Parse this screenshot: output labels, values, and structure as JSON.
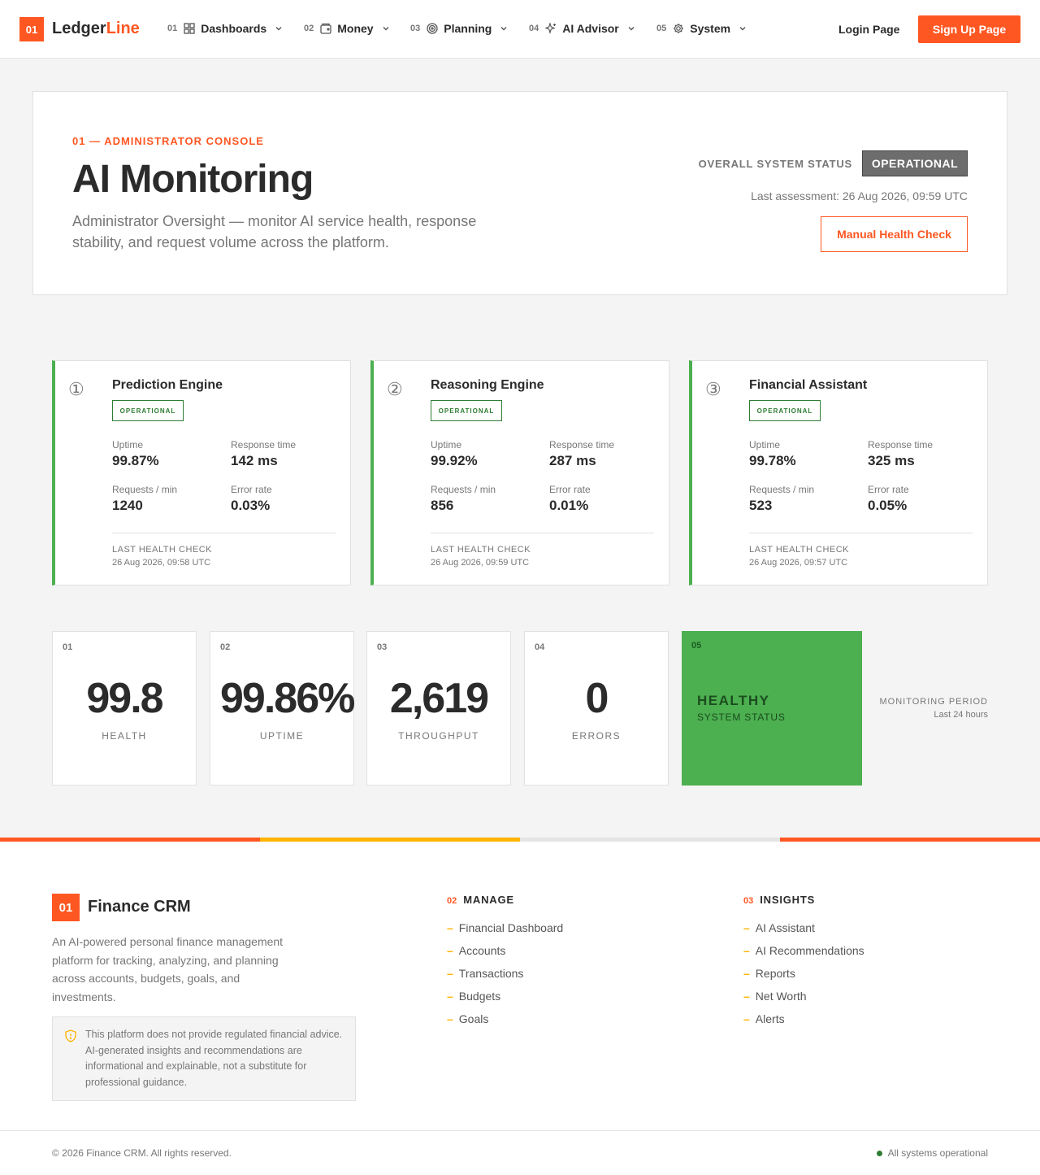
{
  "nav": {
    "logo_num": "01",
    "brand_main": "Ledger",
    "brand_accent": "Line",
    "items": [
      {
        "num": "01",
        "label": "Dashboards",
        "icon": "grid-icon"
      },
      {
        "num": "02",
        "label": "Money",
        "icon": "wallet-icon"
      },
      {
        "num": "03",
        "label": "Planning",
        "icon": "target-icon"
      },
      {
        "num": "04",
        "label": "AI Advisor",
        "icon": "sparkle-icon"
      },
      {
        "num": "05",
        "label": "System",
        "icon": "gear-icon"
      }
    ],
    "login": "Login Page",
    "signup": "Sign Up Page"
  },
  "hero": {
    "eyebrow": "01 — ADMINISTRATOR CONSOLE",
    "title": "AI Monitoring",
    "description": "Administrator Oversight — monitor AI service health, response stability, and request volume across the platform.",
    "status_label": "OVERALL SYSTEM STATUS",
    "status_value": "OPERATIONAL",
    "assessment": "Last assessment: 26 Aug 2026, 09:59 UTC",
    "manual_check": "Manual Health Check"
  },
  "services": [
    {
      "num": "①",
      "name": "Prediction Engine",
      "status": "OPERATIONAL",
      "uptime_label": "Uptime",
      "uptime": "99.87%",
      "response_label": "Response time",
      "response": "142 ms",
      "requests_label": "Requests / min",
      "requests": "1240",
      "error_label": "Error rate",
      "error": "0.03%",
      "lhc_label": "LAST HEALTH CHECK",
      "lhc_time": "26 Aug 2026, 09:58 UTC"
    },
    {
      "num": "②",
      "name": "Reasoning Engine",
      "status": "OPERATIONAL",
      "uptime_label": "Uptime",
      "uptime": "99.92%",
      "response_label": "Response time",
      "response": "287 ms",
      "requests_label": "Requests / min",
      "requests": "856",
      "error_label": "Error rate",
      "error": "0.01%",
      "lhc_label": "LAST HEALTH CHECK",
      "lhc_time": "26 Aug 2026, 09:59 UTC"
    },
    {
      "num": "③",
      "name": "Financial Assistant",
      "status": "OPERATIONAL",
      "uptime_label": "Uptime",
      "uptime": "99.78%",
      "response_label": "Response time",
      "response": "325 ms",
      "requests_label": "Requests / min",
      "requests": "523",
      "error_label": "Error rate",
      "error": "0.05%",
      "lhc_label": "LAST HEALTH CHECK",
      "lhc_time": "26 Aug 2026, 09:57 UTC"
    }
  ],
  "kpis": [
    {
      "num": "01",
      "value": "99.8",
      "label": "HEALTH"
    },
    {
      "num": "02",
      "value": "99.86%",
      "label": "UPTIME"
    },
    {
      "num": "03",
      "value": "2,619",
      "label": "THROUGHPUT"
    },
    {
      "num": "04",
      "value": "0",
      "label": "ERRORS"
    }
  ],
  "kpi_status": {
    "num": "05",
    "value": "HEALTHY",
    "label": "SYSTEM STATUS"
  },
  "period": {
    "label": "MONITORING PERIOD",
    "value": "Last 24 hours"
  },
  "colors": {
    "accent": "#ff5722",
    "success": "#4caf50",
    "warning": "#ffb300",
    "stripe": [
      "#ff5722",
      "#ffb300",
      "#e4e4e4",
      "#ff5722"
    ]
  },
  "footer": {
    "logo_num": "01",
    "brand": "Finance CRM",
    "description": "An AI-powered personal finance management platform for tracking, analyzing, and planning across accounts, budgets, goals, and investments.",
    "notice_icon": "shield-alert-icon",
    "notice": "This platform does not provide regulated financial advice. AI-generated insights and recommendations are informational and explainable, not a substitute for professional guidance.",
    "manage": {
      "num": "02",
      "title": "MANAGE",
      "links": [
        "Financial Dashboard",
        "Accounts",
        "Transactions",
        "Budgets",
        "Goals"
      ]
    },
    "insights": {
      "num": "03",
      "title": "INSIGHTS",
      "links": [
        "AI Assistant",
        "AI Recommendations",
        "Reports",
        "Net Worth",
        "Alerts"
      ]
    },
    "copyright": "© 2026 Finance CRM. All rights reserved.",
    "system_status": "All systems operational"
  }
}
